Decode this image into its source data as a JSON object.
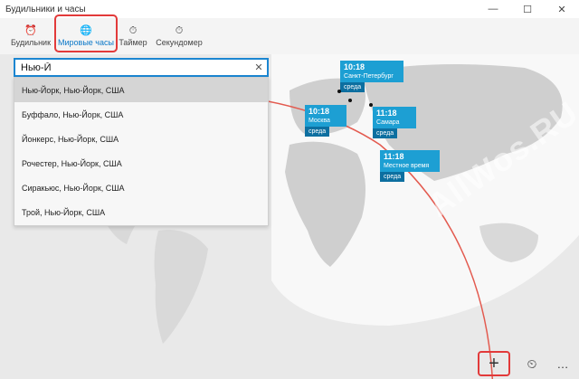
{
  "window": {
    "title": "Будильники и часы",
    "minimize_glyph": "—",
    "maximize_glyph": "☐",
    "close_glyph": "✕"
  },
  "nav": {
    "tabs": [
      {
        "label": "Будильник",
        "icon": "alarm-icon",
        "glyph": "⏰",
        "active": false
      },
      {
        "label": "Мировые часы",
        "icon": "world-clock-icon",
        "glyph": "🌐",
        "active": true
      },
      {
        "label": "Таймер",
        "icon": "timer-icon",
        "glyph": "⏱",
        "active": false
      },
      {
        "label": "Секундомер",
        "icon": "stopwatch-icon",
        "glyph": "⏱",
        "active": false
      }
    ]
  },
  "search": {
    "value": "Нью-Й",
    "clear_glyph": "✕"
  },
  "dropdown": {
    "items": [
      "Нью-Йорк, Нью-Йорк, США",
      "Буффало, Нью-Йорк, США",
      "Йонкерс, Нью-Йорк, США",
      "Рочестер, Нью-Йорк, США",
      "Сиракьюс, Нью-Йорк, США",
      "Трой, Нью-Йорк, США"
    ],
    "selected_index": 0
  },
  "clocks": [
    {
      "time": "10:18",
      "city": "Санкт-Петербург",
      "day": "среда"
    },
    {
      "time": "10:18",
      "city": "Москва",
      "day": "среда"
    },
    {
      "time": "11:18",
      "city": "Самара",
      "day": "среда"
    },
    {
      "time": "11:18",
      "city": "Местное время",
      "day": "среда"
    }
  ],
  "toolbar": {
    "add_glyph": "+",
    "compare_glyph": "⏲",
    "more_glyph": "…"
  },
  "watermark": "AllWos.RU",
  "colors": {
    "accent": "#0a78c8",
    "card": "#1d9fd3",
    "card_day": "#0d6fa0",
    "highlight": "#e23a3a"
  }
}
